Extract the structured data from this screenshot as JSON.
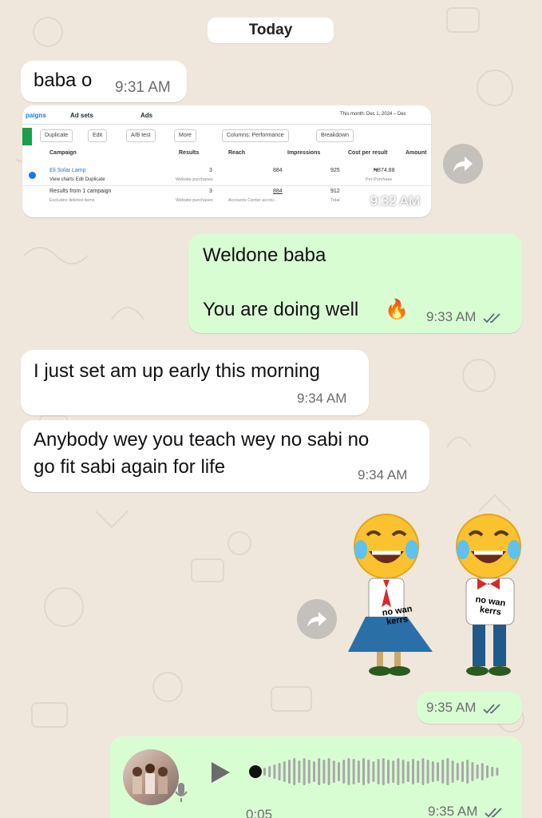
{
  "date_divider": "Today",
  "messages": [
    {
      "text": "baba o",
      "time": "9:31 AM"
    },
    {
      "time": "9:32 AM"
    },
    {
      "lines": [
        "Weldone baba",
        "You are doing well"
      ],
      "emoji": "🔥",
      "time": "9:33 AM"
    },
    {
      "text": "I just set am up early this morning",
      "time": "9:34 AM"
    },
    {
      "lines": [
        "Anybody wey you teach wey no sabi no",
        "go fit sabi again for life"
      ],
      "time": "9:34 AM"
    },
    {
      "sticker_text_left": [
        "no wan",
        "kerrs"
      ],
      "sticker_text_right": [
        "no wan",
        "kerrs"
      ],
      "time": "9:35 AM"
    },
    {
      "duration": "0:05",
      "time": "9:35 AM"
    }
  ],
  "ads_manager": {
    "tabs": [
      "paigns",
      "Ad sets",
      "Ads"
    ],
    "date_range": "This month: Dec 1, 2024 – Dec",
    "toolbar": [
      "Duplicate",
      "Edit",
      "A/B test",
      "More",
      "Columns: Performance",
      "Breakdown"
    ],
    "columns": [
      "Campaign",
      "Results",
      "Reach",
      "Impressions",
      "Cost per result",
      "Amount"
    ],
    "row1": {
      "name": "Eli Solar Lamp",
      "actions": "View charts   Edit   Duplicate",
      "results": "3",
      "results_sub": "Website purchases",
      "reach": "884",
      "impressions": "925",
      "cost": "₦874.88",
      "cost_sub": "Per Purchase"
    },
    "row2": {
      "name": "Results from 1 campaign",
      "name_sub": "Excludes deleted items",
      "results": "3",
      "results_sub": "Website purchases",
      "reach": "884",
      "reach_sub": "Accounts Center accou...",
      "impressions": "912",
      "impressions_sub": "Total"
    }
  },
  "colors": {
    "incoming": "#ffffff",
    "outgoing": "#d9fdd3",
    "background": "#efe7dc",
    "ticks": "#5b6b73"
  }
}
